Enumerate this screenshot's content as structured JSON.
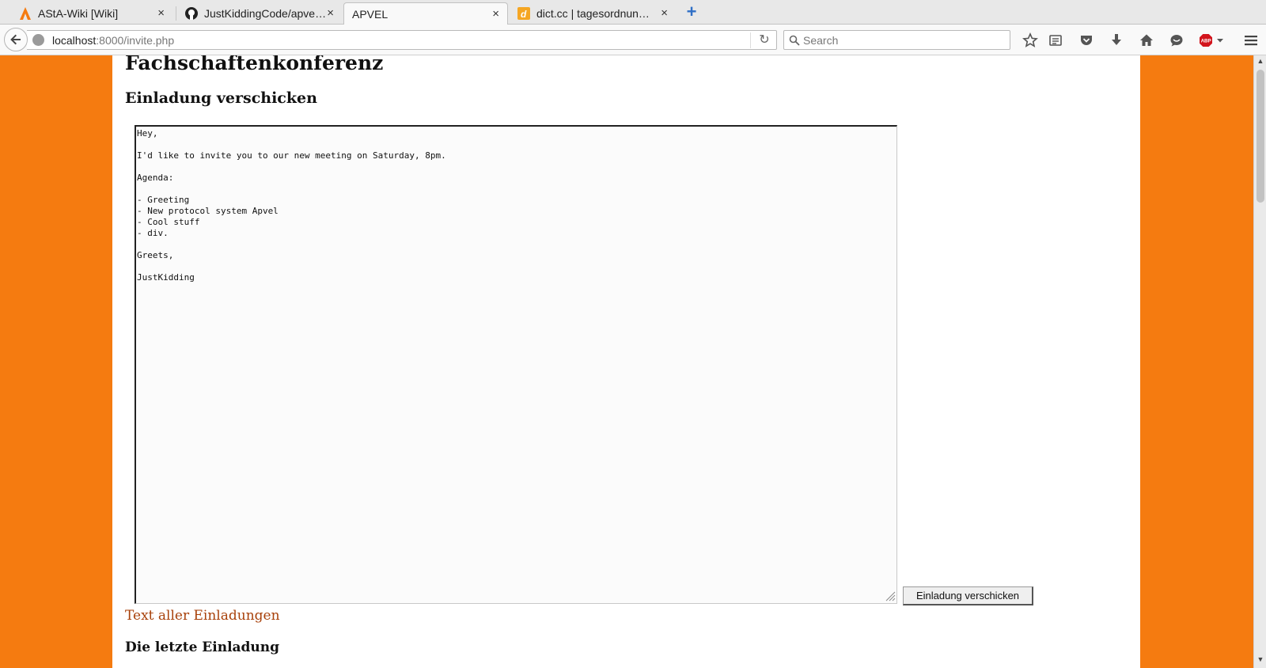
{
  "browser": {
    "tabs": [
      {
        "label": "AStA-Wiki [Wiki]",
        "icon": "asta-logo-icon",
        "active": false
      },
      {
        "label": "JustKiddingCode/apve…",
        "icon": "github-icon",
        "active": false
      },
      {
        "label": "APVEL",
        "icon": "",
        "active": true
      },
      {
        "label": "dict.cc | tagesordnun…",
        "icon": "dictcc-icon",
        "active": false
      }
    ],
    "close_glyph": "×",
    "new_tab_glyph": "+",
    "url": {
      "host": "localhost",
      "rest": ":8000/invite.php"
    },
    "search_placeholder": "Search"
  },
  "page": {
    "title": "Fachschaftenkonferenz",
    "section_title": "Einladung verschicken",
    "invite_text": "Hey,\n\nI'd like to invite you to our new meeting on Saturday, 8pm.\n\nAgenda:\n\n- Greeting\n- New protocol system Apvel\n- Cool stuff\n- div.\n\nGreets,\n\nJustKidding",
    "send_button": "Einladung verschicken",
    "all_invites_link": "Text aller Einladungen",
    "last_invite_heading": "Die letzte Einladung"
  },
  "colors": {
    "page_background": "#f57b10",
    "link": "#a8410a",
    "content_background": "#ffffff"
  }
}
